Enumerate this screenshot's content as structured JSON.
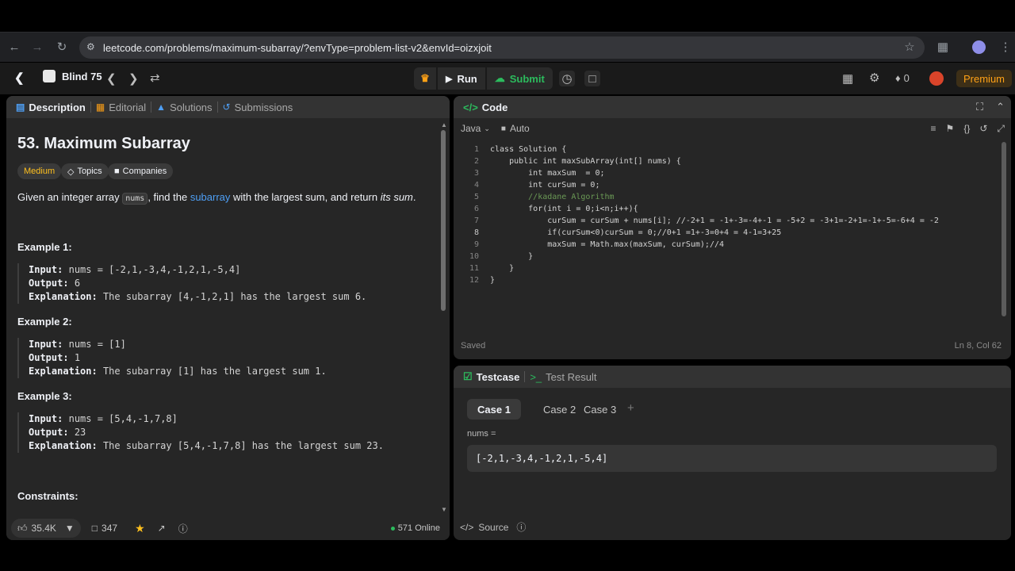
{
  "browser": {
    "url": "leetcode.com/problems/maximum-subarray/?envType=problem-list-v2&envId=oizxjoit",
    "icons": [
      "back-icon",
      "forward-icon",
      "reload-icon",
      "star-icon",
      "extensions-icon",
      "profile-icon",
      "menu-icon"
    ]
  },
  "nav": {
    "problem_list": "Blind 75",
    "run_label": "Run",
    "submit_label": "Submit",
    "streak_count": "0",
    "premium_label": "Premium"
  },
  "left_tabs": {
    "description": "Description",
    "editorial": "Editorial",
    "solutions": "Solutions",
    "submissions": "Submissions"
  },
  "problem": {
    "title": "53. Maximum Subarray",
    "difficulty": "Medium",
    "topics_label": "Topics",
    "companies_label": "Companies",
    "statement_pre": "Given an integer array ",
    "statement_code": "nums",
    "statement_mid": ", find the ",
    "statement_link": "subarray",
    "statement_post": " with the largest sum, and return ",
    "statement_em": "its sum",
    "statement_end": ".",
    "examples": [
      {
        "title": "Example 1:",
        "input": "nums = [-2,1,-3,4,-1,2,1,-5,4]",
        "output": "6",
        "explanation": "The subarray [4,-1,2,1] has the largest sum 6."
      },
      {
        "title": "Example 2:",
        "input": "nums = [1]",
        "output": "1",
        "explanation": "The subarray [1] has the largest sum 1."
      },
      {
        "title": "Example 3:",
        "input": "nums = [5,4,-1,7,8]",
        "output": "23",
        "explanation": "The subarray [5,4,-1,7,8] has the largest sum 23."
      }
    ],
    "input_label": "Input:",
    "output_label": "Output:",
    "explanation_label": "Explanation:",
    "constraints_title": "Constraints:"
  },
  "left_footer": {
    "likes": "35.4K",
    "comments": "347",
    "online": "571 Online"
  },
  "code_panel": {
    "title": "Code",
    "language": "Java",
    "mode": "Auto",
    "status": "Saved",
    "cursor": "Ln 8, Col 62",
    "lines": [
      "class Solution {",
      "    public int maxSubArray(int[] nums) {",
      "        int maxSum  = 0;",
      "        int curSum = 0;",
      "        //kadane Algorithm",
      "        for(int i = 0;i<n;i++){",
      "            curSum = curSum + nums[i]; //-2+1 = -1+-3=-4+-1 = -5+2 = -3+1=-2+1=-1+-5=-6+4 = -2",
      "            if(curSum<0)curSum = 0;//0+1 =1+-3=0+4 = 4-1=3+25",
      "            maxSum = Math.max(maxSum, curSum);//4",
      "        }",
      "    }",
      "}"
    ]
  },
  "test_panel": {
    "testcase_tab": "Testcase",
    "result_tab": "Test Result",
    "cases": [
      "Case 1",
      "Case 2",
      "Case 3"
    ],
    "nums_label": "nums =",
    "nums_value": "[-2,1,-3,4,-1,2,1,-5,4]",
    "source_label": "Source"
  }
}
